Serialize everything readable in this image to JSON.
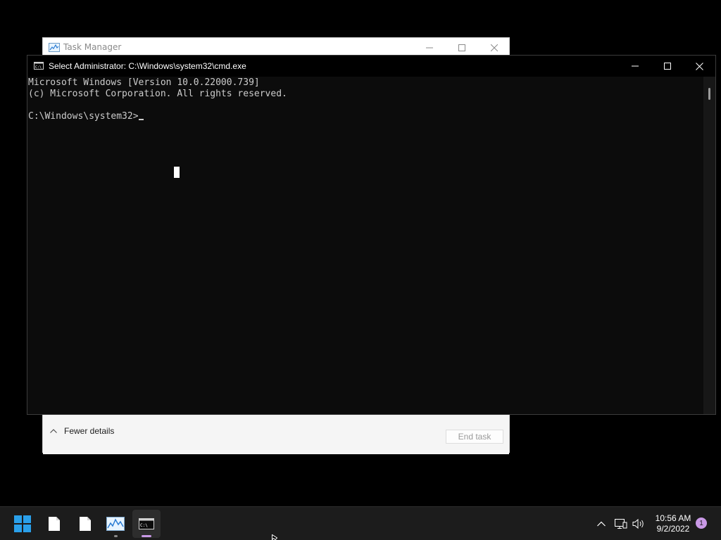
{
  "task_manager": {
    "title": "Task Manager",
    "fewer_details_label": "Fewer details",
    "end_task_label": "End task"
  },
  "cmd": {
    "title": "Select Administrator: C:\\Windows\\system32\\cmd.exe",
    "lines": [
      "Microsoft Windows [Version 10.0.22000.739]",
      "(c) Microsoft Corporation. All rights reserved.",
      "",
      "C:\\Windows\\system32>"
    ]
  },
  "taskbar": {
    "items": [
      {
        "name": "start-button",
        "icon": "windows-logo-icon"
      },
      {
        "name": "file-app-1",
        "icon": "file-icon"
      },
      {
        "name": "file-app-2",
        "icon": "file-icon"
      },
      {
        "name": "task-manager",
        "icon": "task-manager-icon",
        "running": true
      },
      {
        "name": "command-prompt",
        "icon": "terminal-icon",
        "running": true,
        "active": true
      }
    ],
    "tray": {
      "time": "10:56 AM",
      "date": "9/2/2022",
      "notification_count": "1"
    }
  },
  "colors": {
    "console_bg": "#0c0c0c",
    "console_text": "#cccccc",
    "taskbar_bg": "#1c1c1c",
    "accent": "#c999e6",
    "start_blue": "#2aa0ea"
  }
}
